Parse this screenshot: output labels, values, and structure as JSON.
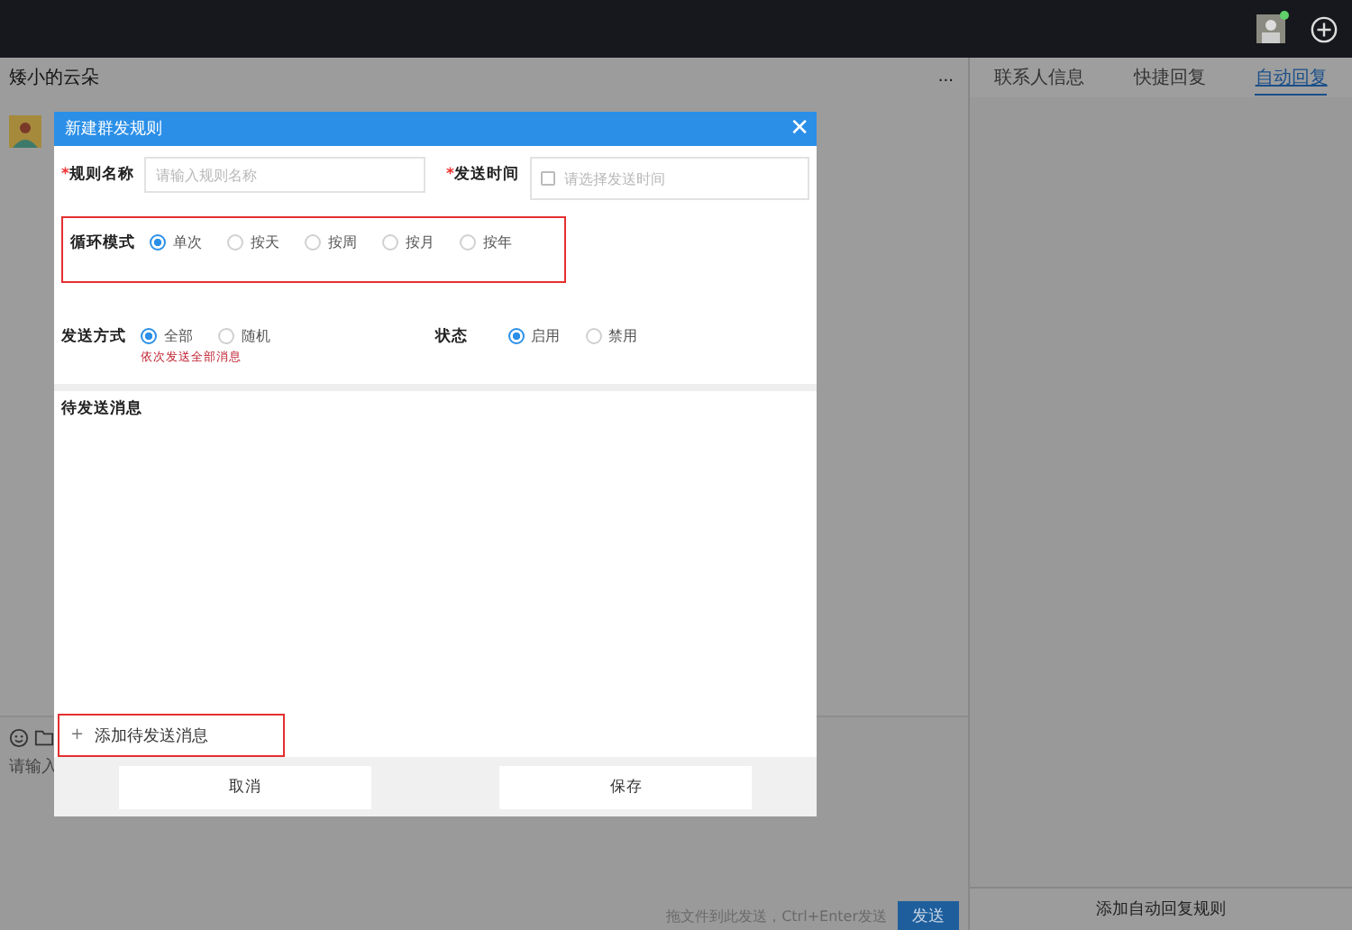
{
  "top_bar": {
    "avatar_online": true
  },
  "chat": {
    "title": "矮小的云朵",
    "more": "...",
    "input_placeholder": "请输入",
    "hint": "拖文件到此发送，Ctrl+Enter发送",
    "send": "发送"
  },
  "side_panel": {
    "tabs": [
      {
        "label": "联系人信息",
        "selected": false
      },
      {
        "label": "快捷回复",
        "selected": false
      },
      {
        "label": "自动回复",
        "selected": true
      }
    ],
    "add_button": "添加自动回复规则"
  },
  "dialog": {
    "title": "新建群发规则",
    "close": "✕",
    "name_field": {
      "label": "规则名称",
      "required": "*",
      "placeholder": "请输入规则名称"
    },
    "time_field": {
      "label": "发送时间",
      "required": "*",
      "placeholder": "请选择发送时间"
    },
    "cycle": {
      "label": "循环模式",
      "highlighted": true,
      "options": [
        {
          "label": "单次",
          "selected": true
        },
        {
          "label": "按天",
          "selected": false
        },
        {
          "label": "按周",
          "selected": false
        },
        {
          "label": "按月",
          "selected": false
        },
        {
          "label": "按年",
          "selected": false
        }
      ]
    },
    "send_mode": {
      "label": "发送方式",
      "hint": "依次发送全部消息",
      "options": [
        {
          "label": "全部",
          "selected": true
        },
        {
          "label": "随机",
          "selected": false
        }
      ]
    },
    "status": {
      "label": "状态",
      "options": [
        {
          "label": "启用",
          "selected": true
        },
        {
          "label": "禁用",
          "selected": false
        }
      ]
    },
    "messages_label": "待发送消息",
    "add_message": {
      "icon": "+",
      "label": "添加待发送消息",
      "highlighted": true
    },
    "buttons": [
      "取消",
      "保存"
    ]
  }
}
